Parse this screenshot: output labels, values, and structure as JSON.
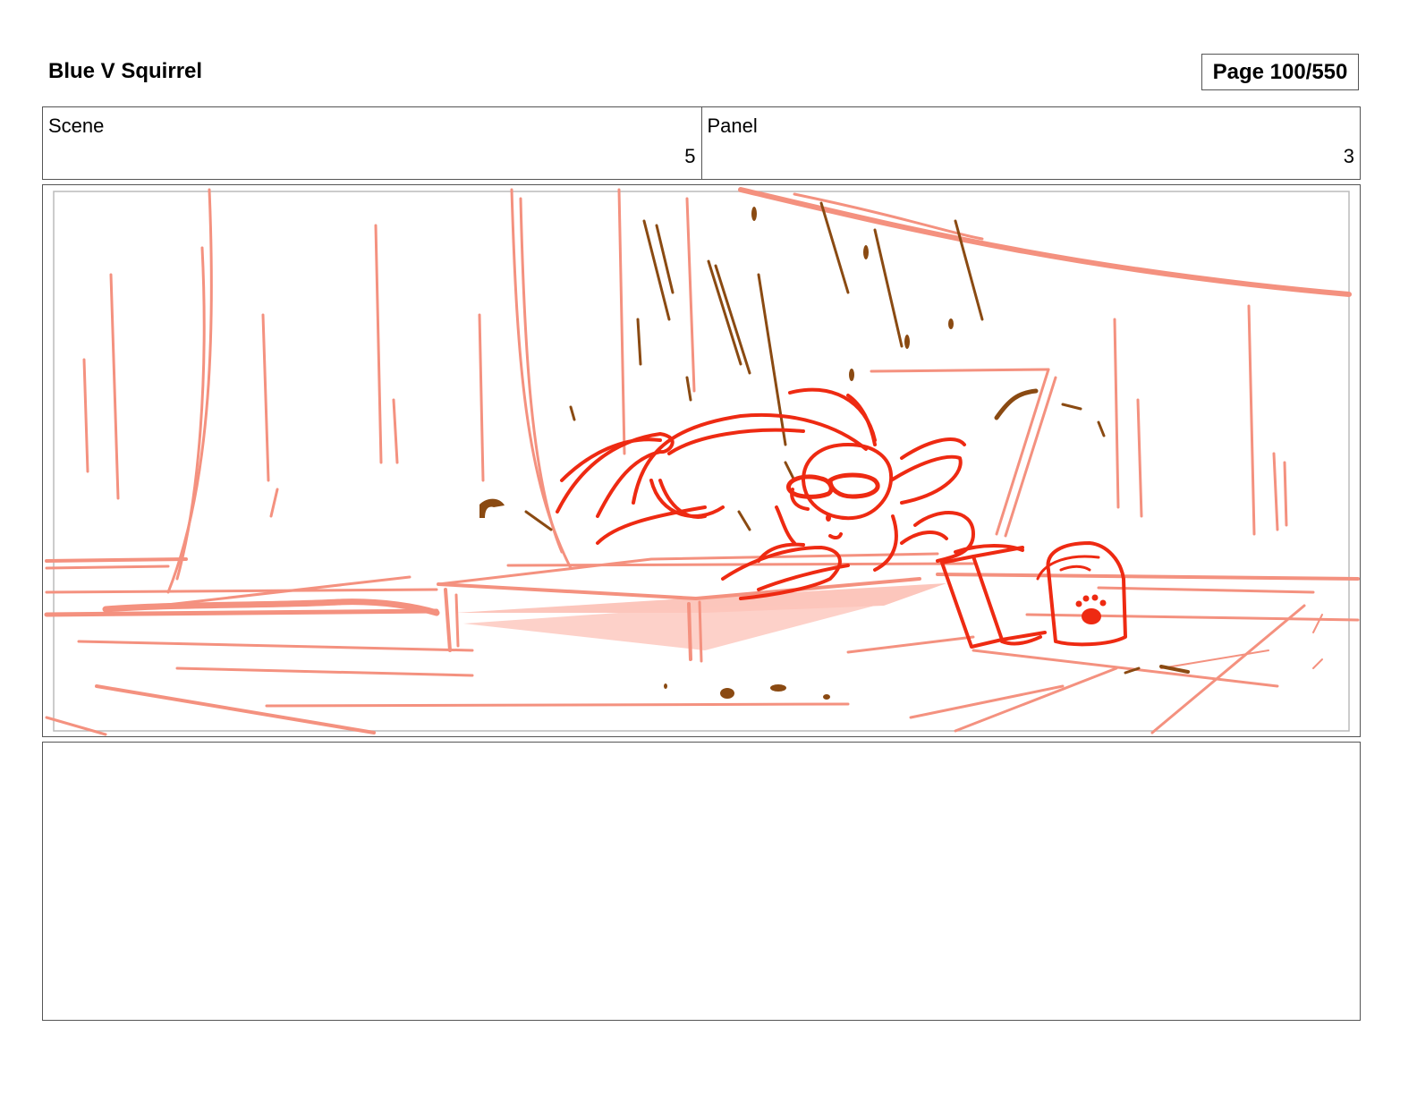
{
  "header": {
    "title": "Blue V Squirrel",
    "page_label": "Page 100/550"
  },
  "meta": {
    "scene_label": "Scene",
    "scene_value": "5",
    "panel_label": "Panel",
    "panel_value": "3"
  },
  "drawing": {
    "subject": "storyboard-sketch-squirrel-crashing-on-table",
    "colors": {
      "background_lines": "#f4917f",
      "character_lines": "#ee2a12",
      "debris": "#8a4a12"
    }
  },
  "notes": {
    "text": ""
  }
}
